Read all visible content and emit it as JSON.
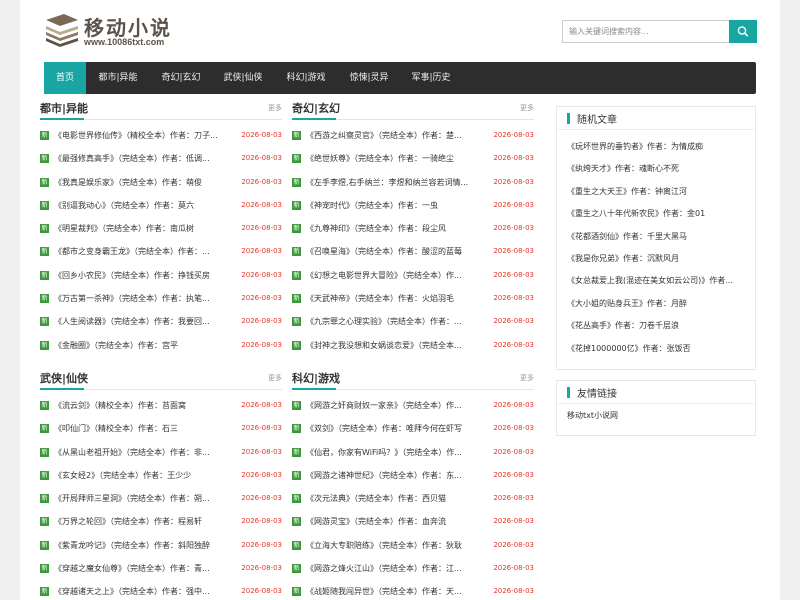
{
  "logo": {
    "title": "移动小说",
    "url": "www.10086txt.com"
  },
  "search": {
    "placeholder": "输入关键词搜索内容...",
    "icon": "search-icon"
  },
  "nav": {
    "items": [
      {
        "label": "首页",
        "active": true
      },
      {
        "label": "都市|异能"
      },
      {
        "label": "奇幻|玄幻"
      },
      {
        "label": "武侠|仙侠"
      },
      {
        "label": "科幻|游戏"
      },
      {
        "label": "惊悚|灵异"
      },
      {
        "label": "军事|历史"
      }
    ]
  },
  "labels": {
    "new_badge": "新",
    "more": "更多"
  },
  "colors": {
    "accent": "#17a6a3",
    "nav_bg": "#2d2d2d",
    "date": "#e3362b",
    "badge": "#3a9a3a"
  },
  "sections": [
    {
      "title": "都市|异能",
      "items": [
        {
          "text": "《电影世界修仙传》（精校全本）作者：刀子...",
          "date": "2026-08-03"
        },
        {
          "text": "《最强修真高手》（完结全本）作者：低调...",
          "date": "2026-08-03"
        },
        {
          "text": "《我真是娱乐家》（完结全本）作者：萌俊",
          "date": "2026-08-03"
        },
        {
          "text": "《别逼我动心》（完结全本）作者：莫六",
          "date": "2026-08-03"
        },
        {
          "text": "《明星裁判》（完结全本）作者：南瓜树",
          "date": "2026-08-03"
        },
        {
          "text": "《都市之变身霸王龙》（完结全本）作者：...",
          "date": "2026-08-03"
        },
        {
          "text": "《回乡小农民》（完结全本）作者：挣钱买房",
          "date": "2026-08-03"
        },
        {
          "text": "《万古第一杀神》（完结全本）作者：执笔...",
          "date": "2026-08-03"
        },
        {
          "text": "《人生阅读器》（完结全本）作者：我要回...",
          "date": "2026-08-03"
        },
        {
          "text": "《金融圈》（完结全本）作者：宫平",
          "date": "2026-08-03"
        }
      ]
    },
    {
      "title": "奇幻|玄幻",
      "items": [
        {
          "text": "《西游之纠察灵官》（完结全本）作者：楚...",
          "date": "2026-08-03"
        },
        {
          "text": "《绝世妖尊》（完结全本）作者：一骑绝尘",
          "date": "2026-08-03"
        },
        {
          "text": "《左手李煜,右手纳兰：李煜和纳兰容若词情...",
          "date": "2026-08-03"
        },
        {
          "text": "《神宠时代》（完结全本）作者：一虫",
          "date": "2026-08-03"
        },
        {
          "text": "《九尊神印》（完结全本）作者：段尘风",
          "date": "2026-08-03"
        },
        {
          "text": "《召唤星海》（完结全本）作者：酸涩的蓝莓",
          "date": "2026-08-03"
        },
        {
          "text": "《幻想之电影世界大冒险》（完结全本）作...",
          "date": "2026-08-03"
        },
        {
          "text": "《天武神帝》（完结全本）作者：火焰羽毛",
          "date": "2026-08-03"
        },
        {
          "text": "《九宗罪之心理实验》（完结全本）作者：...",
          "date": "2026-08-03"
        },
        {
          "text": "《封神之我没想和女娲谈恋爱》（完结全本...",
          "date": "2026-08-03"
        }
      ]
    },
    {
      "title": "武侠|仙侠",
      "items": [
        {
          "text": "《流云剑》（精校全本）作者：苔面窝",
          "date": "2026-08-03"
        },
        {
          "text": "《叩仙门》（精校全本）作者：石三",
          "date": "2026-08-03"
        },
        {
          "text": "《从黑山老祖开始》（完结全本）作者：非...",
          "date": "2026-08-03"
        },
        {
          "text": "《玄女经2》（完结全本）作者：王少少",
          "date": "2026-08-03"
        },
        {
          "text": "《开局拜师三星洞》（完结全本）作者：朔...",
          "date": "2026-08-03"
        },
        {
          "text": "《万界之轮回》（完结全本）作者：程易轩",
          "date": "2026-08-03"
        },
        {
          "text": "《紫青龙吟记》（完结全本）作者：斜阳独醉",
          "date": "2026-08-03"
        },
        {
          "text": "《穿越之魔女仙尊》（完结全本）作者：青...",
          "date": "2026-08-03"
        },
        {
          "text": "《穿越诸天之上》（完结全本）作者：强中...",
          "date": "2026-08-03"
        }
      ]
    },
    {
      "title": "科幻|游戏",
      "items": [
        {
          "text": "《网游之奸商财奴一家亲》（完结全本）作...",
          "date": "2026-08-03"
        },
        {
          "text": "《双剑》（完结全本）作者：唯拜今何在虾写",
          "date": "2026-08-03"
        },
        {
          "text": "《仙君，你家有WiFi吗？》（完结全本）作...",
          "date": "2026-08-03"
        },
        {
          "text": "《网游之诸神世纪》（完结全本）作者：东...",
          "date": "2026-08-03"
        },
        {
          "text": "《次元法典》（完结全本）作者：西贝猫",
          "date": "2026-08-03"
        },
        {
          "text": "《网游灵宝》（完结全本）作者：血奔流",
          "date": "2026-08-03"
        },
        {
          "text": "《立海大专职陪练》（完结全本）作者：狄耿",
          "date": "2026-08-03"
        },
        {
          "text": "《网游之烽火江山》（完结全本）作者：江...",
          "date": "2026-08-03"
        },
        {
          "text": "《战姬随我闯异世》（完结全本）作者：天...",
          "date": "2026-08-03"
        }
      ]
    }
  ],
  "sidebar": {
    "random": {
      "title": "随机文章",
      "items": [
        "《玩坏世界的垂钓者》作者：为情成痴",
        "《纨绔天才》作者：魂断心不死",
        "《重生之大天王》作者：钟离江河",
        "《重生之八十年代新农民》作者：金01",
        "《花都酒剑仙》作者：千里大黑马",
        "《我是你兄弟》作者：沉默风月",
        "《女总裁爱上我(混迹在美女如云公司)》作者...",
        "《大小姐的贴身兵王》作者：月醉",
        "《花丛高手》作者：刀卷千层浪",
        "《花掉1000000亿》作者：张饭否"
      ]
    },
    "links": {
      "title": "友情链接",
      "items": [
        "移动txt小说网"
      ]
    }
  }
}
